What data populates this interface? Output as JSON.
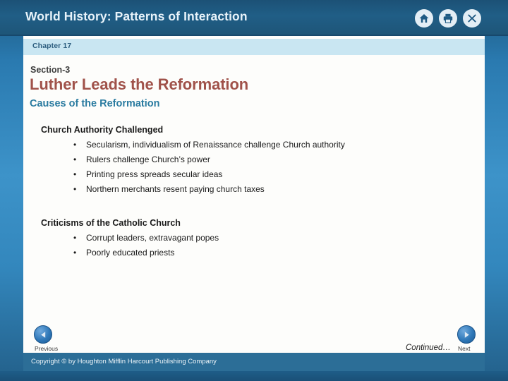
{
  "header": {
    "title": "World History: Patterns of Interaction",
    "icons": [
      {
        "name": "home-icon",
        "label": "Home"
      },
      {
        "name": "print-icon",
        "label": "Print"
      },
      {
        "name": "close-icon",
        "label": "Close"
      }
    ]
  },
  "chapter": {
    "label": "Chapter 17"
  },
  "section": {
    "number_label": "Section-3",
    "title": "Luther Leads the Reformation",
    "subtopic": "Causes of the Reformation"
  },
  "content": {
    "groups": [
      {
        "heading": "Church Authority Challenged",
        "bullets": [
          "Secularism, individualism of Renaissance challenge Church authority",
          "Rulers challenge Church’s power",
          "Printing press spreads secular ideas",
          "Northern merchants resent paying church taxes"
        ]
      },
      {
        "heading": "Criticisms of the Catholic Church",
        "bullets": [
          "Corrupt leaders, extravagant popes",
          "Poorly educated priests"
        ]
      }
    ],
    "bullet_glyph": "•"
  },
  "navigation": {
    "previous_label": "Previous",
    "next_label": "Next",
    "continued_label": "Continued…"
  },
  "footer": {
    "copyright": "Copyright © by Houghton Mifflin Harcourt Publishing Company"
  },
  "colors": {
    "header_blue": "#1f5b84",
    "chapter_band": "#c9e6f2",
    "title_red": "#a0524a",
    "subtopic_teal": "#2a7ba0",
    "footer_blue": "#2c6e97",
    "nav_button_blue": "#2f78b8"
  }
}
